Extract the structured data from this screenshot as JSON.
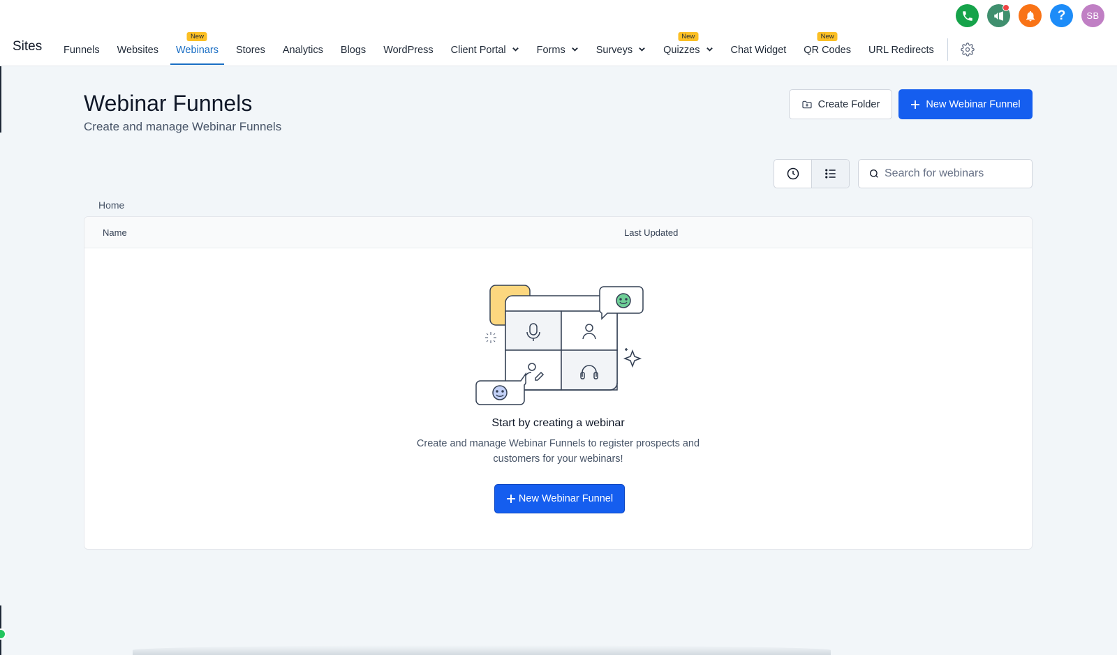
{
  "header": {
    "brand": "Sites",
    "nav": [
      {
        "label": "Funnels",
        "badge": "",
        "dropdown": false,
        "active": false
      },
      {
        "label": "Websites",
        "badge": "",
        "dropdown": false,
        "active": false
      },
      {
        "label": "Webinars",
        "badge": "New",
        "dropdown": false,
        "active": true
      },
      {
        "label": "Stores",
        "badge": "",
        "dropdown": false,
        "active": false
      },
      {
        "label": "Analytics",
        "badge": "",
        "dropdown": false,
        "active": false
      },
      {
        "label": "Blogs",
        "badge": "",
        "dropdown": false,
        "active": false
      },
      {
        "label": "WordPress",
        "badge": "",
        "dropdown": false,
        "active": false
      },
      {
        "label": "Client Portal",
        "badge": "",
        "dropdown": true,
        "active": false
      },
      {
        "label": "Forms",
        "badge": "",
        "dropdown": true,
        "active": false
      },
      {
        "label": "Surveys",
        "badge": "",
        "dropdown": true,
        "active": false
      },
      {
        "label": "Quizzes",
        "badge": "New",
        "dropdown": true,
        "active": false
      },
      {
        "label": "Chat Widget",
        "badge": "",
        "dropdown": false,
        "active": false
      },
      {
        "label": "QR Codes",
        "badge": "New",
        "dropdown": false,
        "active": false
      },
      {
        "label": "URL Redirects",
        "badge": "",
        "dropdown": false,
        "active": false
      }
    ],
    "top_icons": [
      {
        "name": "phone-icon",
        "color": "#16a34a",
        "text": ""
      },
      {
        "name": "megaphone-icon",
        "color": "#3f8f6e",
        "text": "",
        "notification_dot": true
      },
      {
        "name": "bell-icon",
        "color": "#f97316",
        "text": ""
      },
      {
        "name": "help-icon",
        "color": "#1d8cf8",
        "text": "?"
      },
      {
        "name": "avatar",
        "color": "#c07fc4",
        "text": "SB"
      }
    ]
  },
  "page": {
    "title": "Webinar Funnels",
    "subtitle": "Create and manage Webinar Funnels",
    "create_folder_label": "Create Folder",
    "new_funnel_label": "New Webinar Funnel"
  },
  "search": {
    "placeholder": "Search for webinars",
    "value": ""
  },
  "breadcrumb": "Home",
  "table": {
    "columns": [
      "Name",
      "Last Updated"
    ],
    "rows": []
  },
  "empty_state": {
    "title": "Start by creating a webinar",
    "description": "Create and manage Webinar Funnels to register prospects and customers for your webinars!",
    "button_label": "New Webinar Funnel"
  },
  "colors": {
    "primary": "#155eef",
    "active_tab": "#1a6ec4",
    "new_badge": "#fbbf24",
    "background": "#f2f6f9"
  }
}
